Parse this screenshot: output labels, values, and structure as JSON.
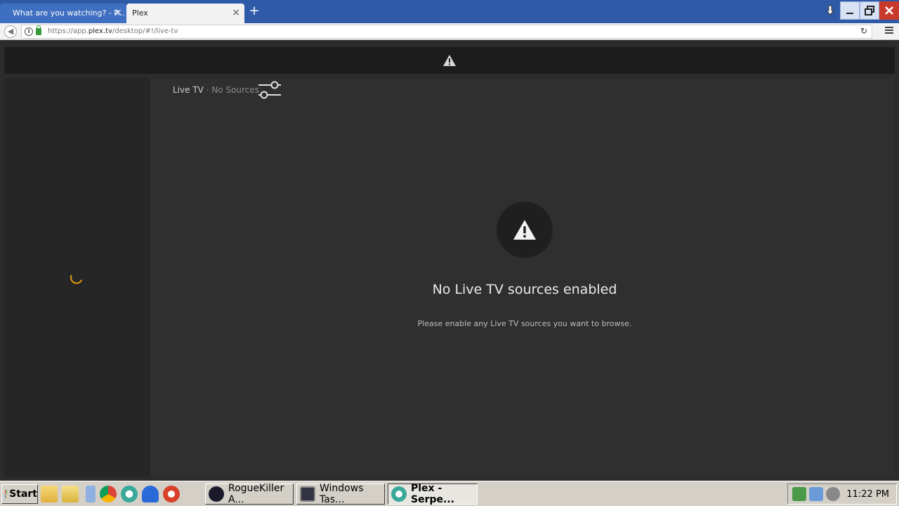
{
  "browser": {
    "tabs": [
      {
        "title": "What are you watching? - P...",
        "active": false
      },
      {
        "title": "Plex",
        "active": true
      }
    ],
    "url_prefix": "https://app.",
    "url_domain": "plex.tv",
    "url_suffix": "/desktop/#!/live-tv"
  },
  "plex": {
    "breadcrumb_title": "Live TV",
    "breadcrumb_separator": " · ",
    "breadcrumb_subtitle": "No Sources",
    "empty_title": "No Live TV sources enabled",
    "empty_description": "Please enable any Live TV sources you want to browse.",
    "accent_color": "#e5a00d"
  },
  "taskbar": {
    "start_label": "Start",
    "tasks": [
      {
        "label": "RogueKiller A...",
        "icon": "roguekiller-icon",
        "active": false
      },
      {
        "label": "Windows Tas...",
        "icon": "task-manager-icon",
        "active": false
      },
      {
        "label": "Plex - Serpe...",
        "icon": "browser-icon",
        "active": true
      }
    ],
    "clock": "11:22 PM"
  }
}
